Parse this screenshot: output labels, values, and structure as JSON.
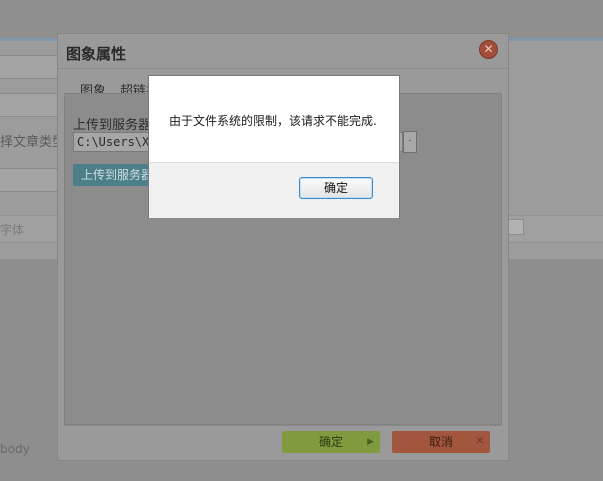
{
  "background": {
    "article_type_label": "择文章类型",
    "font_label": "字体",
    "body_label": "body"
  },
  "image_dialog": {
    "title": "图象属性",
    "tabs": [
      {
        "label": "图象"
      },
      {
        "label": "超链拉"
      }
    ],
    "upload_label": "上传到服务器上",
    "file_path_value": "C:\\Users\\X",
    "browse_glyph": "·",
    "upload_button_label": "上传到服务器上",
    "ok_label": "确定",
    "cancel_label": "取消"
  },
  "alert": {
    "message": "由于文件系统的限制，该请求不能完成.",
    "ok_label": "确定"
  },
  "colors": {
    "ok_green": "#8fb73a",
    "cancel_red": "#d5633f",
    "upload_teal": "#4c9fb0",
    "focus_blue": "#3a8ac9"
  }
}
